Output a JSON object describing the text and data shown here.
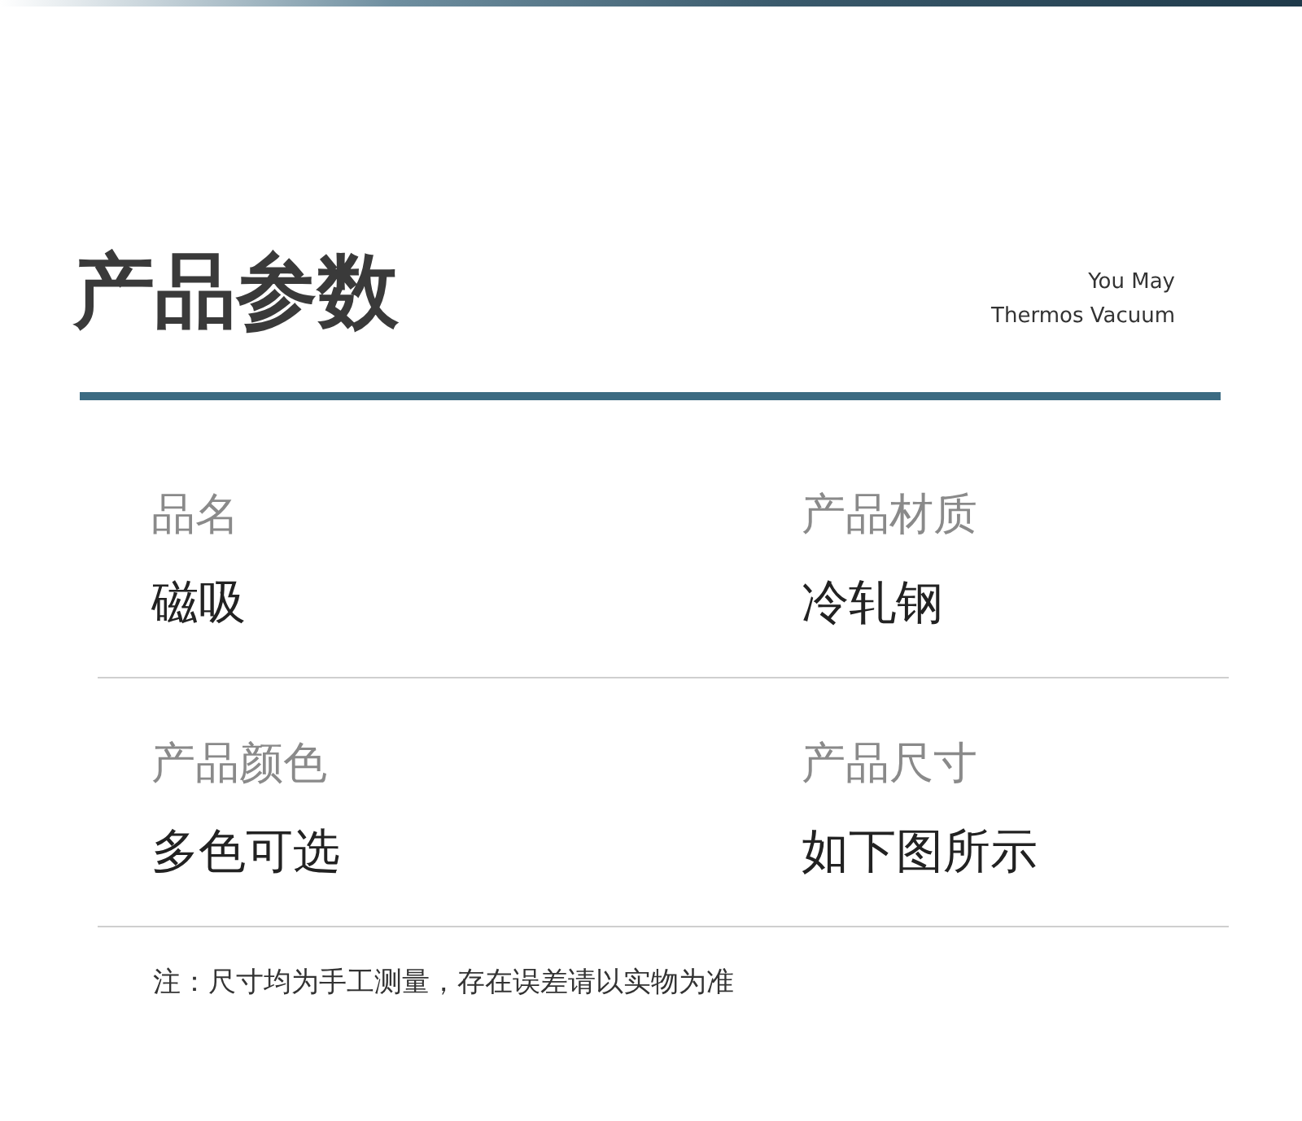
{
  "title": "产品参数",
  "subtitle_lines": [
    "You May",
    "Thermos Vacuum"
  ],
  "params": [
    [
      {
        "label": "品名",
        "value": "磁吸"
      },
      {
        "label": "产品材质",
        "value": "冷轧钢"
      }
    ],
    [
      {
        "label": "产品颜色",
        "value": "多色可选"
      },
      {
        "label": "产品尺寸",
        "value": "如下图所示"
      }
    ]
  ],
  "note": "注：尺寸均为手工测量，存在误差请以实物为准"
}
